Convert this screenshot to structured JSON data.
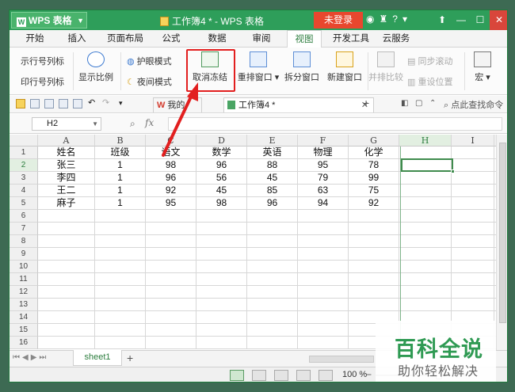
{
  "titlebar": {
    "app_button": "WPS 表格",
    "doc_title": "工作簿4 * - WPS 表格",
    "login": "未登录",
    "icons": [
      "skin-icon",
      "shirt-icon",
      "help-icon",
      "min-to-tray-icon"
    ]
  },
  "menu": {
    "items": [
      "开始",
      "插入",
      "页面布局",
      "公式",
      "数据",
      "审阅",
      "视图",
      "开发工具",
      "云服务"
    ],
    "active": "视图"
  },
  "ribbon": {
    "show_row_col": "示行号列标",
    "print_row_col": "印行号列标",
    "zoom": "显示比例",
    "eye_mode": "护眼模式",
    "night_mode": "夜间模式",
    "unfreeze": "取消冻结",
    "rearrange": "重排窗口",
    "split": "拆分窗口",
    "new_window": "新建窗口",
    "side_by_side": "并排比较",
    "sync_scroll": "同步滚动",
    "reset_pos": "重设位置",
    "macro": "宏"
  },
  "quick_access": {
    "mywps_tab": "我的WPS",
    "book_tab": "工作簿4 *",
    "search": "点此查找命令"
  },
  "formula_bar": {
    "namebox": "H2",
    "fx": "fx",
    "value": ""
  },
  "sheet": {
    "columns": [
      "A",
      "B",
      "C",
      "D",
      "E",
      "F",
      "G",
      "H",
      "I"
    ],
    "rows": [
      "1",
      "2",
      "3",
      "4",
      "5",
      "6",
      "7",
      "8",
      "9",
      "10",
      "11",
      "12",
      "13",
      "14",
      "15",
      "16"
    ],
    "headers": [
      "姓名",
      "班级",
      "语文",
      "数学",
      "英语",
      "物理",
      "化学"
    ],
    "data": [
      [
        "张三",
        "1",
        "98",
        "96",
        "88",
        "95",
        "78"
      ],
      [
        "李四",
        "1",
        "96",
        "56",
        "45",
        "79",
        "99"
      ],
      [
        "王二",
        "1",
        "92",
        "45",
        "85",
        "63",
        "75"
      ],
      [
        "麻子",
        "1",
        "95",
        "98",
        "96",
        "94",
        "92"
      ]
    ],
    "active_cell": "H2"
  },
  "tabs": {
    "sheets": [
      "sheet1"
    ],
    "add": "+"
  },
  "status": {
    "zoom": "100 %"
  },
  "watermark": {
    "title": "百科全说",
    "subtitle": "助你轻松解决"
  },
  "colors": {
    "accent": "#2e9e5a",
    "highlight": "#e21f1f",
    "login": "#e8472e"
  }
}
